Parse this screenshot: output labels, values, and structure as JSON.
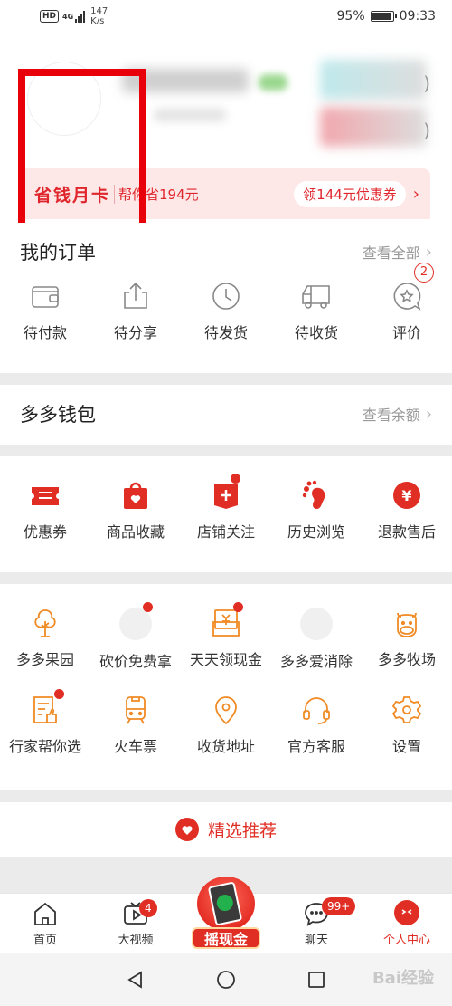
{
  "status_bar": {
    "hd": "HD",
    "network": "4G",
    "speed_value": "147",
    "speed_unit": "K/s",
    "battery_percent": "95%",
    "battery_level": 0.95,
    "time": "09:33"
  },
  "profile": {
    "bracket": ")",
    "card": {
      "title": "省钱月卡",
      "saving": "帮你省194元",
      "coupon_button": "领144元优惠券",
      "chevron": "›"
    }
  },
  "orders": {
    "title": "我的订单",
    "view_all": "查看全部",
    "arrow": "›",
    "items": [
      {
        "label": "待付款",
        "icon": "wallet-icon"
      },
      {
        "label": "待分享",
        "icon": "share-icon"
      },
      {
        "label": "待发货",
        "icon": "clock-icon"
      },
      {
        "label": "待收货",
        "icon": "truck-icon"
      },
      {
        "label": "评价",
        "icon": "review-icon",
        "badge": "2"
      }
    ]
  },
  "wallet": {
    "title": "多多钱包",
    "view_balance": "查看余额",
    "arrow": "›"
  },
  "services": {
    "items": [
      {
        "label": "优惠券",
        "icon": "coupon-icon"
      },
      {
        "label": "商品收藏",
        "icon": "favorite-bag-icon"
      },
      {
        "label": "店铺关注",
        "icon": "store-follow-icon"
      },
      {
        "label": "历史浏览",
        "icon": "footprint-icon"
      },
      {
        "label": "退款售后",
        "icon": "refund-icon"
      }
    ]
  },
  "tools": {
    "row1": [
      {
        "label": "多多果园",
        "icon": "tree-icon"
      },
      {
        "label": "砍价免费拿",
        "icon": "placeholder-icon"
      },
      {
        "label": "天天领现金",
        "icon": "cash-envelope-icon"
      },
      {
        "label": "多多爱消除",
        "icon": "placeholder-icon"
      },
      {
        "label": "多多牧场",
        "icon": "cow-icon"
      }
    ],
    "row2": [
      {
        "label": "行家帮你选",
        "icon": "recommend-doc-icon"
      },
      {
        "label": "火车票",
        "icon": "train-icon"
      },
      {
        "label": "收货地址",
        "icon": "location-icon"
      },
      {
        "label": "官方客服",
        "icon": "headset-icon"
      },
      {
        "label": "设置",
        "icon": "settings-gear-icon"
      }
    ]
  },
  "recommend": {
    "title": "精选推荐"
  },
  "tabbar": {
    "items": [
      {
        "label": "首页",
        "icon": "home-icon"
      },
      {
        "label": "大视频",
        "icon": "video-icon",
        "badge": "4"
      },
      {
        "label": "摇现金",
        "icon": "shake-cash-icon"
      },
      {
        "label": "聊天",
        "icon": "chat-icon",
        "badge": "99+"
      },
      {
        "label": "个人中心",
        "icon": "profile-icon"
      }
    ]
  },
  "watermark": "Bai经验",
  "colors": {
    "accent": "#e02e24",
    "orange": "#f08a24",
    "highlight_box": "#e8000b"
  }
}
